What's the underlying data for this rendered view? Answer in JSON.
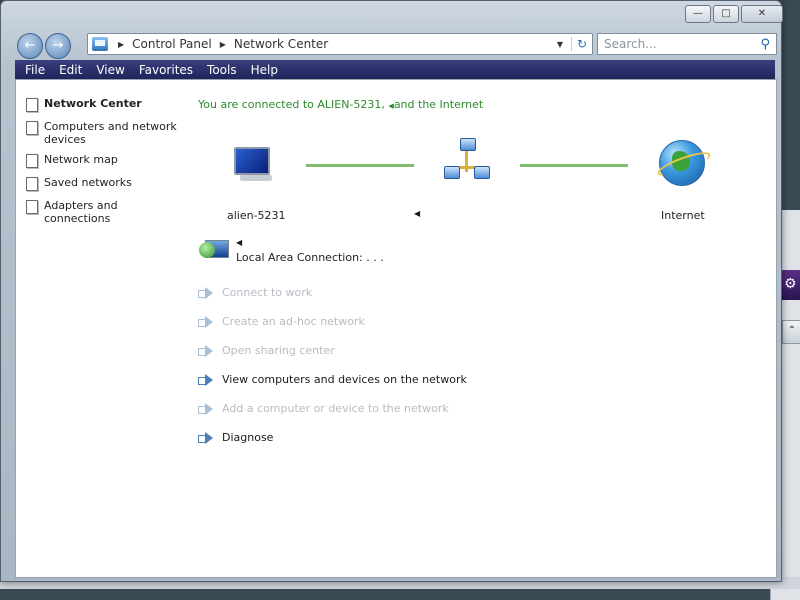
{
  "window": {
    "caption_buttons": [
      "minimize",
      "maximize",
      "close"
    ]
  },
  "address": {
    "segments": [
      "Control Panel",
      "Network Center"
    ],
    "icon": "control-panel-icon"
  },
  "search": {
    "placeholder": "Search..."
  },
  "menu": [
    "File",
    "Edit",
    "View",
    "Favorites",
    "Tools",
    "Help"
  ],
  "tasks": [
    {
      "label": "Network Center",
      "bold": true
    },
    {
      "label": "Computers and network devices"
    },
    {
      "label": "Network map"
    },
    {
      "label": "Saved networks"
    },
    {
      "label": "Adapters and connections"
    }
  ],
  "status": {
    "text": "You are connected to ALIEN-5231, ",
    "suffix": "and the Internet"
  },
  "map": {
    "left_label": "alien-5231",
    "right_label": "Internet",
    "line_color": "#7fbf6b"
  },
  "connection": {
    "label": "Local Area Connection:  . . ."
  },
  "actions": [
    {
      "label": "Connect to work",
      "enabled": false
    },
    {
      "label": "Create an ad-hoc network",
      "enabled": false
    },
    {
      "label": "Open sharing center",
      "enabled": false
    },
    {
      "label": "View computers and devices on the network",
      "enabled": true
    },
    {
      "label": "Add a computer or device to the network",
      "enabled": false
    },
    {
      "label": "Diagnose",
      "enabled": true
    }
  ]
}
